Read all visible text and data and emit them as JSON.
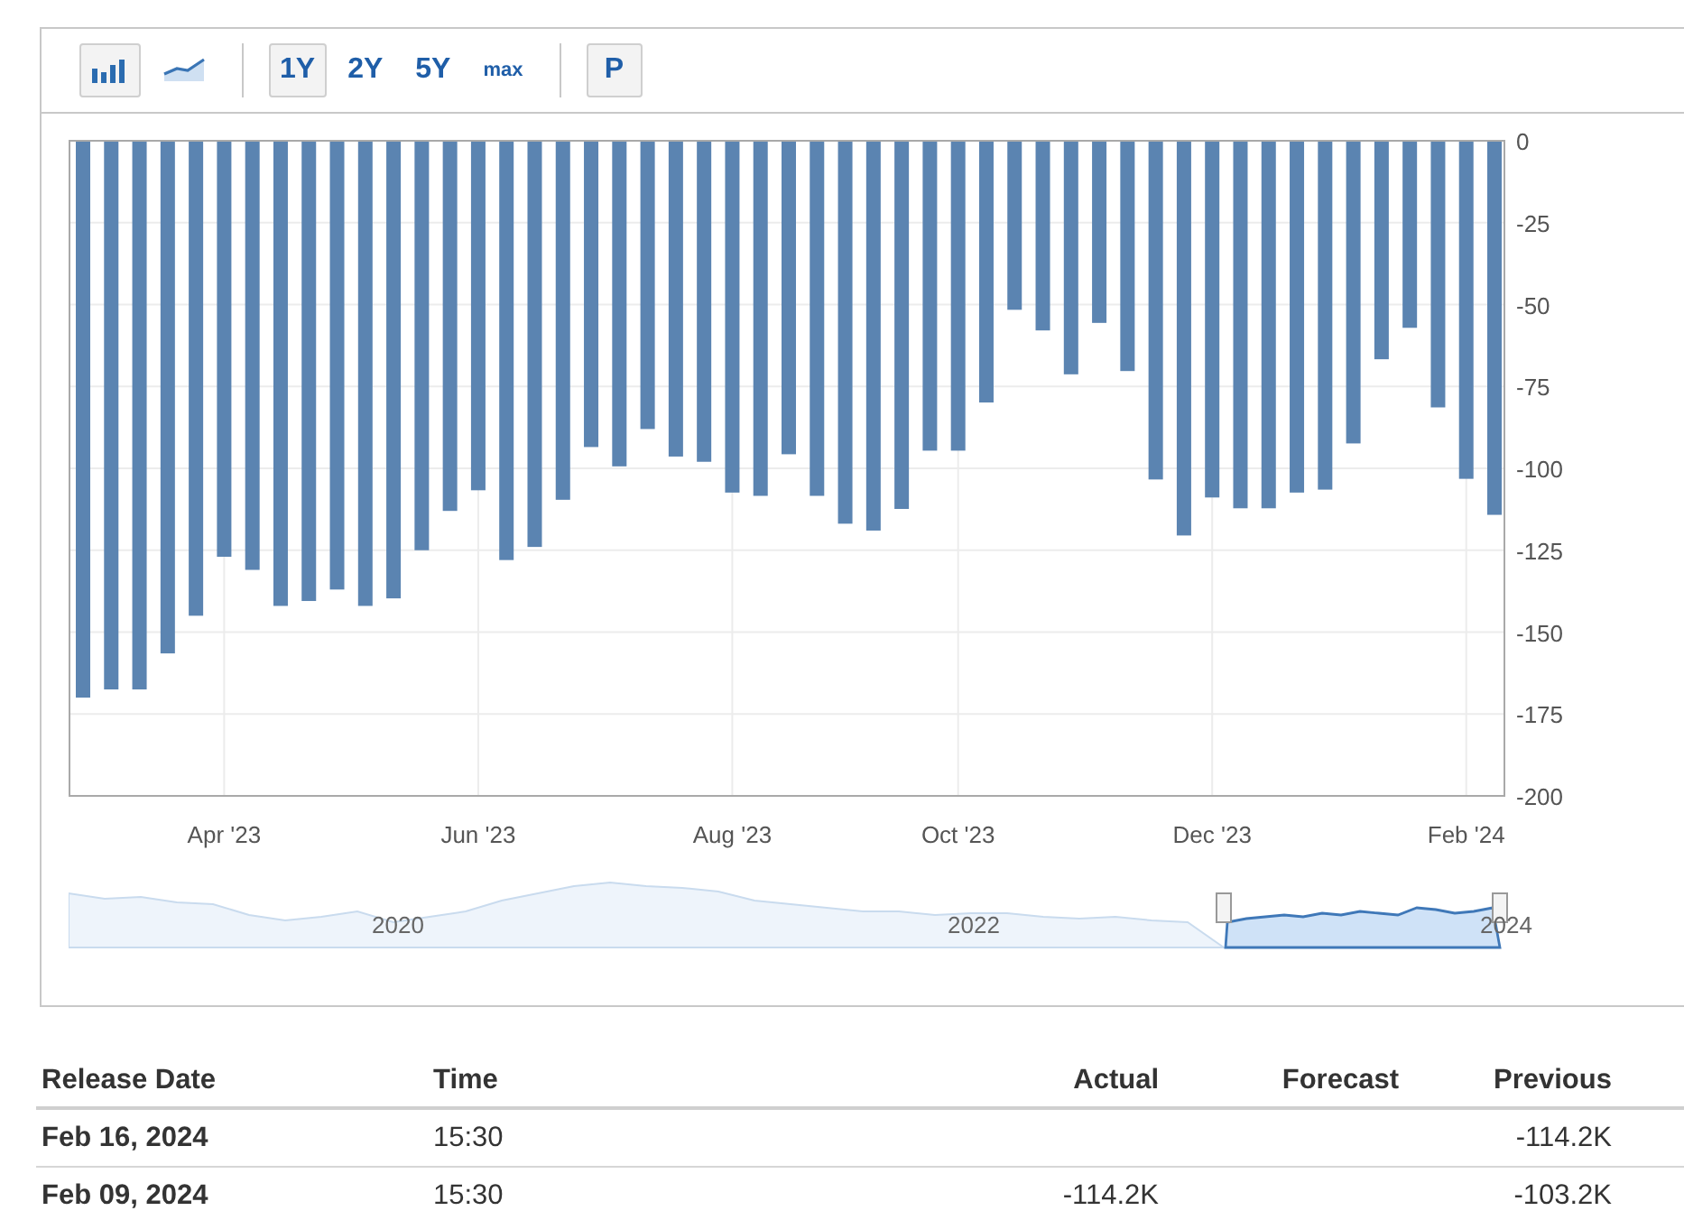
{
  "toolbar": {
    "chart_types": [
      {
        "kind": "bar",
        "selected": true
      },
      {
        "kind": "line",
        "selected": false
      }
    ],
    "ranges": [
      {
        "label": "1Y",
        "selected": true
      },
      {
        "label": "2Y",
        "selected": false
      },
      {
        "label": "5Y",
        "selected": false
      },
      {
        "label": "max",
        "selected": false
      }
    ],
    "extra_button": {
      "label": "P"
    }
  },
  "chart": {
    "chart_data": {
      "type": "bar",
      "grid": true,
      "categories": [
        null,
        null,
        null,
        null,
        null,
        "Apr '23",
        null,
        null,
        null,
        null,
        null,
        null,
        null,
        null,
        "Jun '23",
        null,
        null,
        null,
        null,
        null,
        null,
        null,
        null,
        "Aug '23",
        null,
        null,
        null,
        null,
        null,
        null,
        null,
        "Oct '23",
        null,
        null,
        null,
        null,
        null,
        null,
        null,
        null,
        "Dec '23",
        null,
        null,
        null,
        null,
        null,
        null,
        null,
        null,
        "Feb '24",
        null
      ],
      "series": [
        {
          "color": "#5b84b1",
          "values": [
            -170,
            -167.5,
            -167.5,
            -156.5,
            -145,
            -127,
            -131,
            -142,
            -140.5,
            -137,
            -142,
            -139.7,
            -125,
            -113,
            -106.7,
            -128,
            -124,
            -109.6,
            -93.5,
            -99.4,
            -88,
            -96.4,
            -98,
            -107.4,
            -108.4,
            -95.7,
            -108.4,
            -116.9,
            -119,
            -112.4,
            -94.6,
            -94.6,
            -79.9,
            -51.6,
            -57.9,
            -71.3,
            -55.6,
            -70.3,
            -103.4,
            -120.5,
            -108.9,
            -112.2,
            -112.2,
            -107.4,
            -106.5,
            -92.4,
            -66.7,
            -57.1,
            -81.4,
            -103.2,
            -114.2
          ]
        }
      ],
      "ylim": [
        -200,
        0
      ],
      "yticks": [
        0,
        -25,
        -50,
        -75,
        -100,
        -125,
        -150,
        -175,
        -200
      ]
    }
  },
  "navigator": {
    "labels": [
      "2020",
      "2022",
      "2024"
    ]
  },
  "table": {
    "columns": [
      "Release Date",
      "Time",
      "Actual",
      "Forecast",
      "Previous"
    ],
    "rows": [
      {
        "release_date": "Feb 16, 2024",
        "time": "15:30",
        "previous": "-114.2K"
      },
      {
        "release_date": "Feb 09, 2024",
        "time": "15:30",
        "actual": "-114.2K",
        "previous": "-103.2K"
      }
    ]
  }
}
